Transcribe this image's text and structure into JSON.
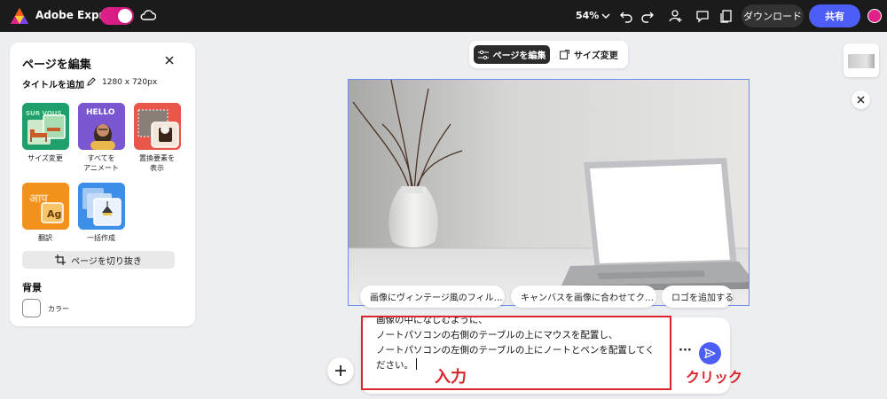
{
  "topbar": {
    "app_title": "Adobe Express",
    "zoom": "54%",
    "download_label": "ダウンロード",
    "share_label": "共有"
  },
  "panel": {
    "title": "ページを編集",
    "title_row_label": "タイトルを追加",
    "size_text": "1280 x 720px",
    "tiles": [
      {
        "label": "サイズ変更"
      },
      {
        "label": "すべてを\nアニメート"
      },
      {
        "label": "置換要素を\n表示"
      },
      {
        "label": "翻訳"
      },
      {
        "label": "一括作成"
      }
    ],
    "tile_art": {
      "resize_top": "SUR VOUS",
      "animate_top": "HELLO",
      "translate_a": "आप",
      "translate_b": "Ag"
    },
    "crop_label": "ページを切り抜き",
    "background_title": "背景",
    "color_label": "カラー"
  },
  "canvas_tabs": {
    "edit_page": "ページを編集",
    "resize": "サイズ変更"
  },
  "suggestions": [
    "画像にヴィンテージ風のフィル…",
    "キャンバスを画像に合わせてク…",
    "ロゴを追加する"
  ],
  "prompt": {
    "lines": [
      "画像の中になじむように、",
      "ノートパソコンの右側のテーブルの上にマウスを配置し、",
      "ノートパソコンの左側のテーブルの上にノートとペンを配置してく",
      "ださい。"
    ]
  },
  "annotations": {
    "input": "入力",
    "click": "クリック"
  },
  "colors": {
    "accent": "#4c5ef7",
    "annotation_red": "#d9252b",
    "brand_pink": "#e0218a"
  }
}
